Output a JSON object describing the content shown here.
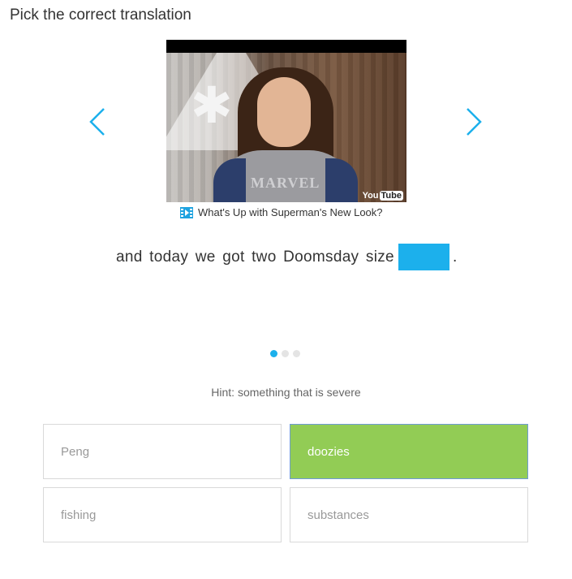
{
  "page": {
    "title": "Pick the correct translation"
  },
  "carousel": {
    "prev_icon": "chevron-left-icon",
    "next_icon": "chevron-right-icon",
    "accent_color": "#1cb0ec",
    "active_slide": 1,
    "slide_count": 3
  },
  "video": {
    "shirt_text": "MARVEL",
    "badge_you": "You",
    "badge_tube": "Tube",
    "caption_icon": "film-icon",
    "caption": "What's Up with Superman's New Look?"
  },
  "sentence": {
    "text": "and today we got two Doomsday size",
    "end": "."
  },
  "hint": "Hint: something that is severe",
  "options": [
    {
      "label": "Peng",
      "selected": false
    },
    {
      "label": "doozies",
      "selected": true,
      "color": "#92cc55"
    },
    {
      "label": "fishing",
      "selected": false
    },
    {
      "label": "substances",
      "selected": false
    }
  ]
}
